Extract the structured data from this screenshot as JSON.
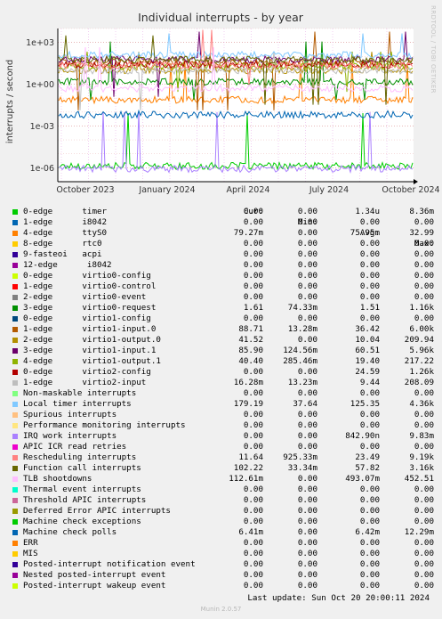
{
  "chart_data": {
    "type": "line",
    "title": "Individual interrupts - by year",
    "ylabel": "interrupts / second",
    "y_scale": "log",
    "yticks": [
      "1e-06",
      "1e-03",
      "1e+00",
      "1e+03"
    ],
    "ylim": [
      1e-07,
      10000.0
    ],
    "x_tick_labels": [
      "October 2023",
      "January 2024",
      "April 2024",
      "July 2024",
      "October 2024"
    ],
    "grid": true,
    "columns": [
      "Cur:",
      "Min:",
      "Avg:",
      "Max:"
    ],
    "series": [
      {
        "name": "0-edge      timer",
        "color": "#00cc00",
        "cur": "0.00",
        "min": "0.00",
        "avg": "1.34u",
        "max": "8.36m"
      },
      {
        "name": "1-edge      i8042",
        "color": "#0066b3",
        "cur": "0.00",
        "min": "0.00",
        "avg": "0.00",
        "max": "0.00"
      },
      {
        "name": "4-edge      ttyS0",
        "color": "#ff8000",
        "cur": "79.27m",
        "min": "0.00",
        "avg": "75.95m",
        "max": "32.99"
      },
      {
        "name": "8-edge      rtc0",
        "color": "#ffcc00",
        "cur": "0.00",
        "min": "0.00",
        "avg": "0.00",
        "max": "0.00"
      },
      {
        "name": "9-fasteoi   acpi",
        "color": "#330099",
        "cur": "0.00",
        "min": "0.00",
        "avg": "0.00",
        "max": "0.00"
      },
      {
        "name": "12-edge      i8042",
        "color": "#990099",
        "cur": "0.00",
        "min": "0.00",
        "avg": "0.00",
        "max": "0.00"
      },
      {
        "name": "0-edge      virtio0-config",
        "color": "#ccff00",
        "cur": "0.00",
        "min": "0.00",
        "avg": "0.00",
        "max": "0.00"
      },
      {
        "name": "1-edge      virtio0-control",
        "color": "#ff0000",
        "cur": "0.00",
        "min": "0.00",
        "avg": "0.00",
        "max": "0.00"
      },
      {
        "name": "2-edge      virtio0-event",
        "color": "#808080",
        "cur": "0.00",
        "min": "0.00",
        "avg": "0.00",
        "max": "0.00"
      },
      {
        "name": "3-edge      virtio0-request",
        "color": "#008f00",
        "cur": "1.61",
        "min": "74.33m",
        "avg": "1.51",
        "max": "1.16k"
      },
      {
        "name": "0-edge      virtio1-config",
        "color": "#00487d",
        "cur": "0.00",
        "min": "0.00",
        "avg": "0.00",
        "max": "0.00"
      },
      {
        "name": "1-edge      virtio1-input.0",
        "color": "#b35a00",
        "cur": "88.71",
        "min": "13.28m",
        "avg": "36.42",
        "max": "6.00k"
      },
      {
        "name": "2-edge      virtio1-output.0",
        "color": "#b38f00",
        "cur": "41.52",
        "min": "0.00",
        "avg": "10.04",
        "max": "209.94"
      },
      {
        "name": "3-edge      virtio1-input.1",
        "color": "#6b006b",
        "cur": "85.90",
        "min": "124.56m",
        "avg": "60.51",
        "max": "5.96k"
      },
      {
        "name": "4-edge      virtio1-output.1",
        "color": "#8fb300",
        "cur": "40.40",
        "min": "285.46m",
        "avg": "19.40",
        "max": "217.22"
      },
      {
        "name": "0-edge      virtio2-config",
        "color": "#b30000",
        "cur": "0.00",
        "min": "0.00",
        "avg": "24.59",
        "max": "1.26k"
      },
      {
        "name": "1-edge      virtio2-input",
        "color": "#bebebe",
        "cur": "16.28m",
        "min": "13.23m",
        "avg": "9.44",
        "max": "208.09"
      },
      {
        "name": "Non-maskable interrupts",
        "color": "#80ff80",
        "cur": "0.00",
        "min": "0.00",
        "avg": "0.00",
        "max": "0.00"
      },
      {
        "name": "Local timer interrupts",
        "color": "#80c9ff",
        "cur": "179.19",
        "min": "37.64",
        "avg": "125.35",
        "max": "4.36k"
      },
      {
        "name": "Spurious interrupts",
        "color": "#ffc080",
        "cur": "0.00",
        "min": "0.00",
        "avg": "0.00",
        "max": "0.00"
      },
      {
        "name": "Performance monitoring interrupts",
        "color": "#ffe680",
        "cur": "0.00",
        "min": "0.00",
        "avg": "0.00",
        "max": "0.00"
      },
      {
        "name": "IRQ work interrupts",
        "color": "#aa80ff",
        "cur": "0.00",
        "min": "0.00",
        "avg": "842.90n",
        "max": "9.83m"
      },
      {
        "name": "APIC ICR read retries",
        "color": "#ee00cc",
        "cur": "0.00",
        "min": "0.00",
        "avg": "0.00",
        "max": "0.00"
      },
      {
        "name": "Rescheduling interrupts",
        "color": "#ff8080",
        "cur": "11.64",
        "min": "925.33m",
        "avg": "23.49",
        "max": "9.19k"
      },
      {
        "name": "Function call interrupts",
        "color": "#666600",
        "cur": "102.22",
        "min": "33.34m",
        "avg": "57.82",
        "max": "3.16k"
      },
      {
        "name": "TLB shootdowns",
        "color": "#ffbfff",
        "cur": "112.61m",
        "min": "0.00",
        "avg": "493.07m",
        "max": "452.51"
      },
      {
        "name": "Thermal event interrupts",
        "color": "#00ffcc",
        "cur": "0.00",
        "min": "0.00",
        "avg": "0.00",
        "max": "0.00"
      },
      {
        "name": "Threshold APIC interrupts",
        "color": "#cc6699",
        "cur": "0.00",
        "min": "0.00",
        "avg": "0.00",
        "max": "0.00"
      },
      {
        "name": "Deferred Error APIC interrupts",
        "color": "#999900",
        "cur": "0.00",
        "min": "0.00",
        "avg": "0.00",
        "max": "0.00"
      },
      {
        "name": "Machine check exceptions",
        "color": "#00cc00",
        "cur": "0.00",
        "min": "0.00",
        "avg": "0.00",
        "max": "0.00"
      },
      {
        "name": "Machine check polls",
        "color": "#0066b3",
        "cur": "6.41m",
        "min": "0.00",
        "avg": "6.42m",
        "max": "12.29m"
      },
      {
        "name": "ERR",
        "color": "#ff8000",
        "cur": "0.00",
        "min": "0.00",
        "avg": "0.00",
        "max": "0.00"
      },
      {
        "name": "MIS",
        "color": "#ffcc00",
        "cur": "0.00",
        "min": "0.00",
        "avg": "0.00",
        "max": "0.00"
      },
      {
        "name": "Posted-interrupt notification event",
        "color": "#330099",
        "cur": "0.00",
        "min": "0.00",
        "avg": "0.00",
        "max": "0.00"
      },
      {
        "name": "Nested posted-interrupt event",
        "color": "#990099",
        "cur": "0.00",
        "min": "0.00",
        "avg": "0.00",
        "max": "0.00"
      },
      {
        "name": "Posted-interrupt wakeup event",
        "color": "#ccff00",
        "cur": "0.00",
        "min": "0.00",
        "avg": "0.00",
        "max": "0.00"
      }
    ]
  },
  "footer": {
    "last_update": "Last update:  Sun Oct 20 20:00:11 2024",
    "munin_version": "Munin 2.0.57",
    "rrdtool_label": "RRDTOOL / TOBI OETIKER"
  }
}
